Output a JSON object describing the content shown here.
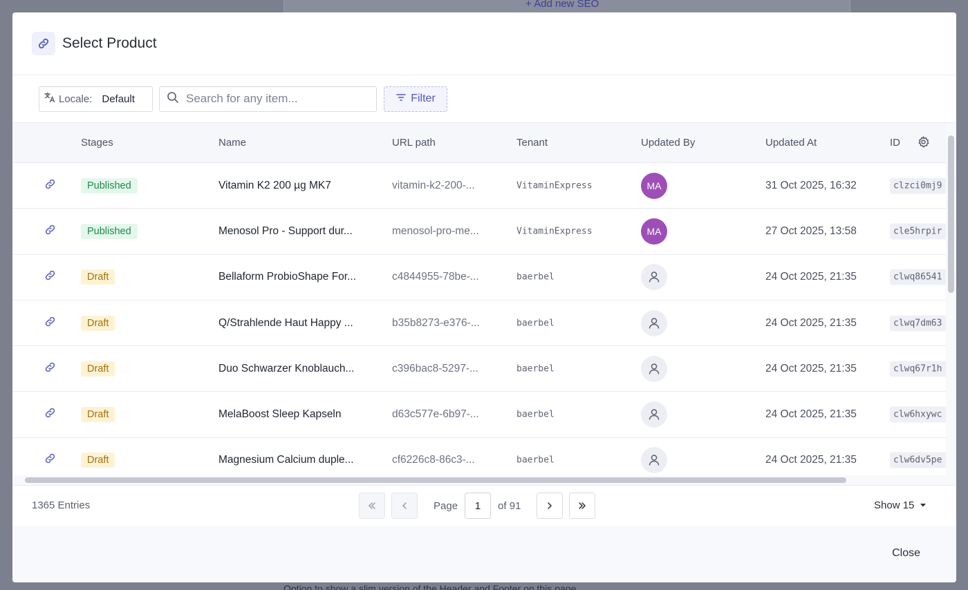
{
  "background": {
    "add_seo_label": "+ Add new SEO",
    "bottom_note": "Option to show a slim version of the Header and Footer on this page"
  },
  "modal": {
    "title": "Select Product",
    "icon": "link-icon"
  },
  "toolbar": {
    "locale_label": "Locale:",
    "locale_value": "Default",
    "search_placeholder": "Search for any item...",
    "filter_label": "Filter"
  },
  "table": {
    "columns": [
      "Stages",
      "Name",
      "URL path",
      "Tenant",
      "Updated By",
      "Updated At",
      "ID"
    ],
    "rows": [
      {
        "stage": "Published",
        "name": "Vitamin K2 200 µg MK7",
        "url": "vitamin-k2-200-...",
        "tenant": "VitaminExpress",
        "updated_by": "MA",
        "updated_at": "31 Oct 2025, 16:32",
        "id": "clzci0mj9"
      },
      {
        "stage": "Published",
        "name": "Menosol Pro - Support dur...",
        "url": "menosol-pro-me...",
        "tenant": "VitaminExpress",
        "updated_by": "MA",
        "updated_at": "27 Oct 2025, 13:58",
        "id": "cle5hrpir"
      },
      {
        "stage": "Draft",
        "name": "Bellaform ProbioShape For...",
        "url": "c4844955-78be-...",
        "tenant": "baerbel",
        "updated_by": "",
        "updated_at": "24 Oct 2025, 21:35",
        "id": "clwq86541"
      },
      {
        "stage": "Draft",
        "name": "Q/Strahlende Haut Happy ...",
        "url": "b35b8273-e376-...",
        "tenant": "baerbel",
        "updated_by": "",
        "updated_at": "24 Oct 2025, 21:35",
        "id": "clwq7dm63"
      },
      {
        "stage": "Draft",
        "name": "Duo Schwarzer Knoblauch...",
        "url": "c396bac8-5297-...",
        "tenant": "baerbel",
        "updated_by": "",
        "updated_at": "24 Oct 2025, 21:35",
        "id": "clwq67r1h"
      },
      {
        "stage": "Draft",
        "name": "MelaBoost Sleep Kapseln",
        "url": "d63c577e-6b97-...",
        "tenant": "baerbel",
        "updated_by": "",
        "updated_at": "24 Oct 2025, 21:35",
        "id": "clw6hxywc"
      },
      {
        "stage": "Draft",
        "name": "Magnesium Calcium duple...",
        "url": "cf6226c8-86c3-...",
        "tenant": "baerbel",
        "updated_by": "",
        "updated_at": "24 Oct 2025, 21:35",
        "id": "clw6dv5pe"
      }
    ]
  },
  "footer": {
    "entries": "1365 Entries",
    "page_label": "Page",
    "page_value": "1",
    "of_label": "of 91",
    "show_label": "Show 15"
  },
  "close_label": "Close",
  "colors": {
    "published_bg": "#e4f7ec",
    "published_text": "#1f8a4a",
    "draft_bg": "#fdf3d4",
    "draft_text": "#a4700d",
    "avatar": "#9d4fb7",
    "accent": "#4f56b8"
  }
}
